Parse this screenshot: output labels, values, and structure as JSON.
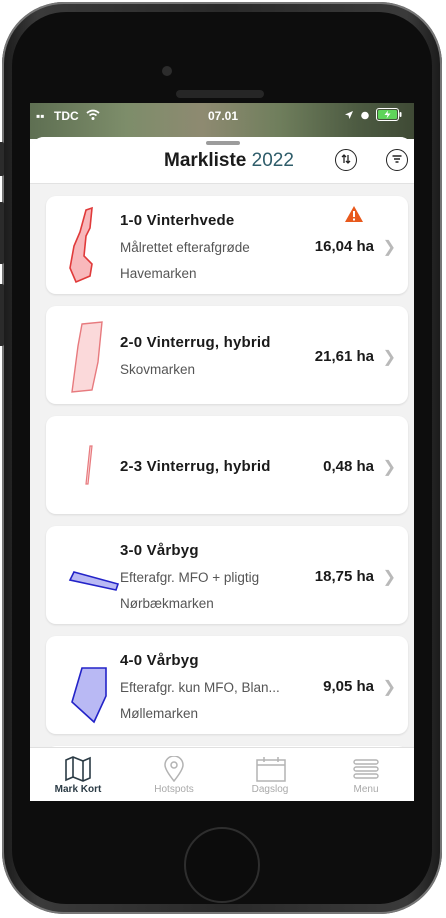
{
  "status_bar": {
    "carrier": "TDC",
    "time": "07.01"
  },
  "header": {
    "title": "Markliste",
    "year": "2022"
  },
  "fields": [
    {
      "name": "1-0  Vinterhvede",
      "line1": "Målrettet efterafgrøde",
      "line2": "Havemarken",
      "area": "16,04 ha",
      "warning": true,
      "color": "#e03a3a",
      "fill": "#f8b8bb"
    },
    {
      "name": "2-0  Vinterrug, hybrid",
      "line1": "Skovmarken",
      "line2": "",
      "area": "21,61 ha",
      "warning": false,
      "color": "#e77a7e",
      "fill": "#fbd9da"
    },
    {
      "name": "2-3  Vinterrug, hybrid",
      "line1": "",
      "line2": "",
      "area": "0,48 ha",
      "warning": false,
      "color": "#e77a7e",
      "fill": "#fbd9da"
    },
    {
      "name": "3-0  Vårbyg",
      "line1": "Efterafgr. MFO + pligtig",
      "line2": "Nørbækmarken",
      "area": "18,75 ha",
      "warning": false,
      "color": "#2323c8",
      "fill": "#b9b9f4"
    },
    {
      "name": "4-0  Vårbyg",
      "line1": "Efterafgr. kun MFO, Blan...",
      "line2": "Møllemarken",
      "area": "9,05 ha",
      "warning": false,
      "color": "#2323c8",
      "fill": "#b9b9f4"
    }
  ],
  "tabs": [
    {
      "label": "Mark Kort",
      "icon": "map-icon",
      "active": true
    },
    {
      "label": "Hotspots",
      "icon": "location-pin-icon",
      "active": false
    },
    {
      "label": "Dagslog",
      "icon": "calendar-icon",
      "active": false
    },
    {
      "label": "Menu",
      "icon": "menu-icon",
      "active": false
    }
  ],
  "colors": {
    "warning": "#e8591c",
    "accent": "#2f5d6a"
  }
}
